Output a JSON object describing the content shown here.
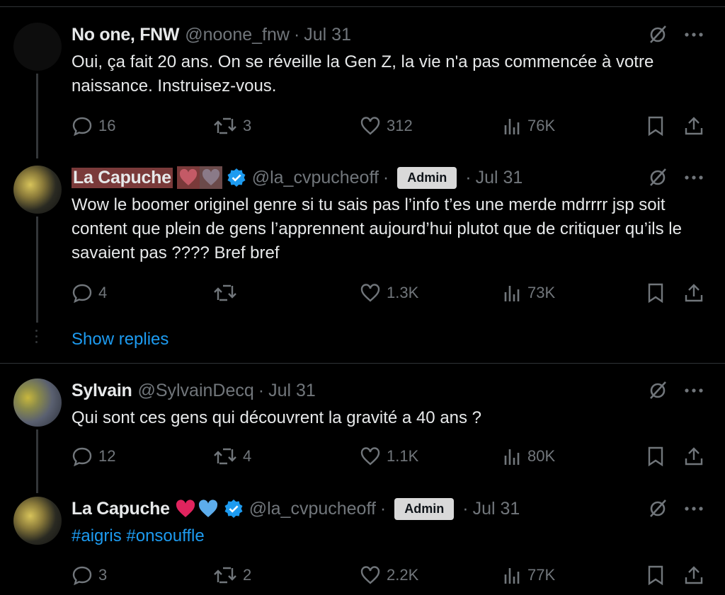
{
  "tweets": [
    {
      "name": "No one, FNW",
      "handle": "@noone_fnw",
      "date": "Jul 31",
      "text": "Oui, ça fait 20 ans. On se réveille la Gen Z, la vie n'a pas commencée à votre naissance. Instruisez-vous.",
      "replies": "16",
      "reposts": "3",
      "likes": "312",
      "views": "76K"
    },
    {
      "name": "La Capuche",
      "handle": "@la_cvpucheoff",
      "badge": "Admin",
      "date": "Jul 31",
      "text": "Wow le boomer originel genre si tu sais pas l’info t’es une merde mdrrrr jsp soit content que plein de gens l’apprennent aujourd’hui plutot que de critiquer qu’ils le savaient pas ???? Bref bref",
      "replies": "4",
      "reposts": "",
      "likes": "1.3K",
      "views": "73K"
    },
    {
      "name": "Sylvain",
      "handle": "@SylvainDecq",
      "date": "Jul 31",
      "text": "Qui sont ces gens qui découvrent la gravité a 40 ans ?",
      "replies": "12",
      "reposts": "4",
      "likes": "1.1K",
      "views": "80K"
    },
    {
      "name": "La Capuche",
      "handle": "@la_cvpucheoff",
      "badge": "Admin",
      "date": "Jul 31",
      "hashtags": "#aigris #onsouffle",
      "replies": "3",
      "reposts": "2",
      "likes": "2.2K",
      "views": "77K"
    }
  ],
  "show_replies": "Show replies",
  "separator": "·",
  "colors": {
    "background": "#000000",
    "text": "#e7e9ea",
    "muted": "#71767b",
    "accent": "#1d9bf0",
    "verified": "#1d9bf0"
  }
}
